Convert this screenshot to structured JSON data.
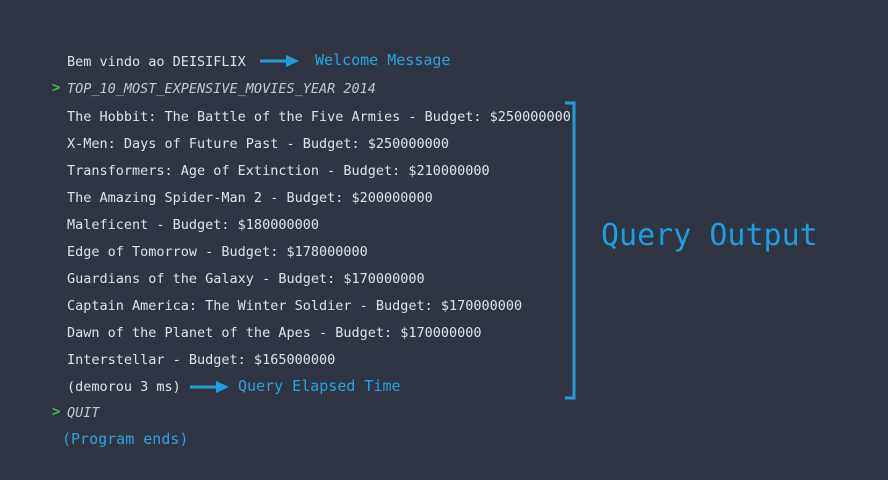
{
  "console": {
    "welcome_line": "Bem vindo ao DEISIFLIX",
    "command": "TOP_10_MOST_EXPENSIVE_MOVIES_YEAR 2014",
    "results": [
      "The Hobbit: The Battle of the Five Armies - Budget: $250000000",
      "X-Men: Days of Future Past - Budget: $250000000",
      "Transformers: Age of Extinction - Budget: $210000000",
      "The Amazing Spider-Man 2 - Budget: $200000000",
      "Maleficent - Budget: $180000000",
      "Edge of Tomorrow - Budget: $178000000",
      "Guardians of the Galaxy - Budget: $170000000",
      "Captain America: The Winter Soldier - Budget: $170000000",
      "Dawn of the Planet of the Apes - Budget: $170000000",
      "Interstellar - Budget: $165000000"
    ],
    "elapsed": "(demorou 3 ms)",
    "quit_command": "QUIT",
    "program_ends": "(Program ends)",
    "prompt_symbol": ">"
  },
  "annotations": {
    "welcome": "Welcome Message",
    "query_output": "Query Output",
    "elapsed": "Query Elapsed Time"
  },
  "colors": {
    "background": "#2f3542",
    "text": "#dfe3e8",
    "prompt": "#3fbf4a",
    "annotation": "#29a3e0"
  }
}
